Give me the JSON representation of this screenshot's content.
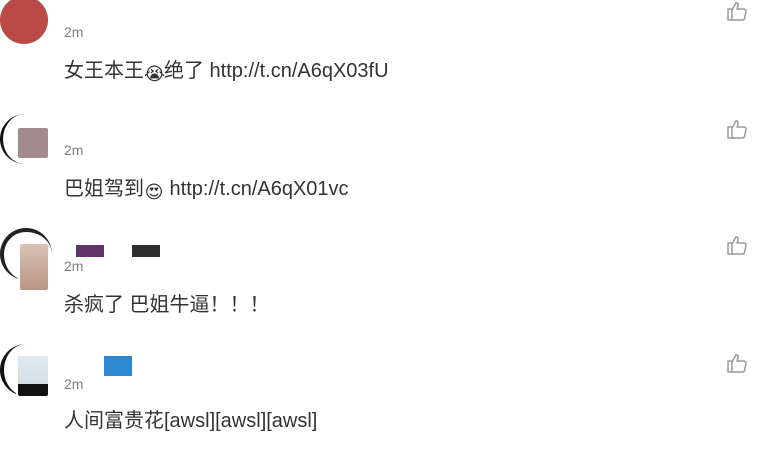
{
  "comments": [
    {
      "time": "2m",
      "text_before": "女王本王",
      "emoji": "😭",
      "text_after": "绝了 http://t.cn/A6qX03fU",
      "avatar_color": "#b94a45"
    },
    {
      "time": "2m",
      "text_before": "巴姐驾到",
      "emoji": "😍",
      "text_after": " http://t.cn/A6qX01vc",
      "avatar_color": "#a38a8f"
    },
    {
      "time": "2m",
      "text_before": "杀疯了 巴姐牛逼！！！",
      "emoji": "",
      "text_after": "",
      "avatar_color": "#c9b3a4",
      "name_colors": [
        "#5e3566",
        "#2f2f2f"
      ]
    },
    {
      "time": "2m",
      "text_before": "人间富贵花[awsl][awsl][awsl]",
      "emoji": "",
      "text_after": "",
      "avatar_color": "#d8e2ea",
      "name_colors": [
        "#2f88d2"
      ]
    }
  ],
  "icons": {
    "like": "thumbs-up-icon"
  }
}
